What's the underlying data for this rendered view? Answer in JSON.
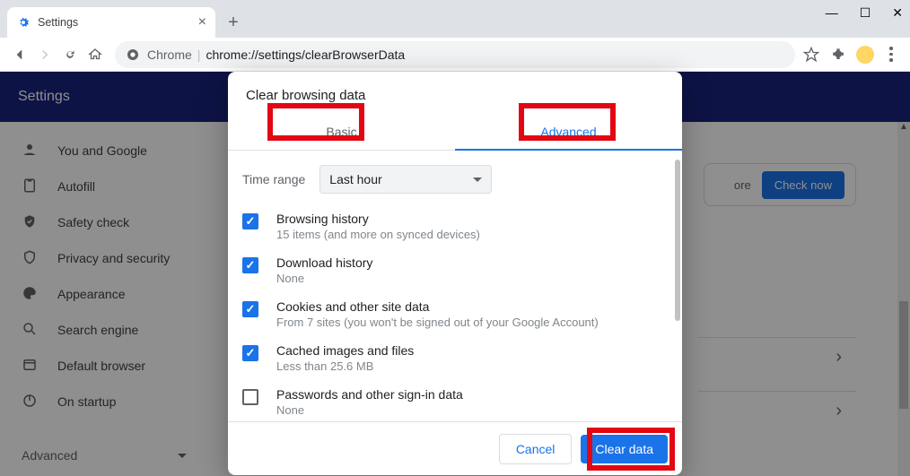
{
  "window": {
    "tab_title": "Settings"
  },
  "toolbar": {
    "url_label": "Chrome",
    "url": "chrome://settings/clearBrowserData"
  },
  "page": {
    "header": "Settings",
    "sidebar": [
      {
        "icon": "person",
        "label": "You and Google"
      },
      {
        "icon": "autofill",
        "label": "Autofill"
      },
      {
        "icon": "shield",
        "label": "Safety check"
      },
      {
        "icon": "lock",
        "label": "Privacy and security"
      },
      {
        "icon": "palette",
        "label": "Appearance"
      },
      {
        "icon": "search",
        "label": "Search engine"
      },
      {
        "icon": "browser",
        "label": "Default browser"
      },
      {
        "icon": "power",
        "label": "On startup"
      }
    ],
    "advanced_label": "Advanced",
    "more_text": "ore",
    "check_now": "Check now"
  },
  "modal": {
    "title": "Clear browsing data",
    "tabs": {
      "basic": "Basic",
      "advanced": "Advanced"
    },
    "time_range_label": "Time range",
    "time_range_value": "Last hour",
    "items": [
      {
        "checked": true,
        "title": "Browsing history",
        "sub": "15 items (and more on synced devices)"
      },
      {
        "checked": true,
        "title": "Download history",
        "sub": "None"
      },
      {
        "checked": true,
        "title": "Cookies and other site data",
        "sub": "From 7 sites (you won't be signed out of your Google Account)"
      },
      {
        "checked": true,
        "title": "Cached images and files",
        "sub": "Less than 25.6 MB"
      },
      {
        "checked": false,
        "title": "Passwords and other sign-in data",
        "sub": "None"
      }
    ],
    "cancel": "Cancel",
    "clear": "Clear data"
  }
}
